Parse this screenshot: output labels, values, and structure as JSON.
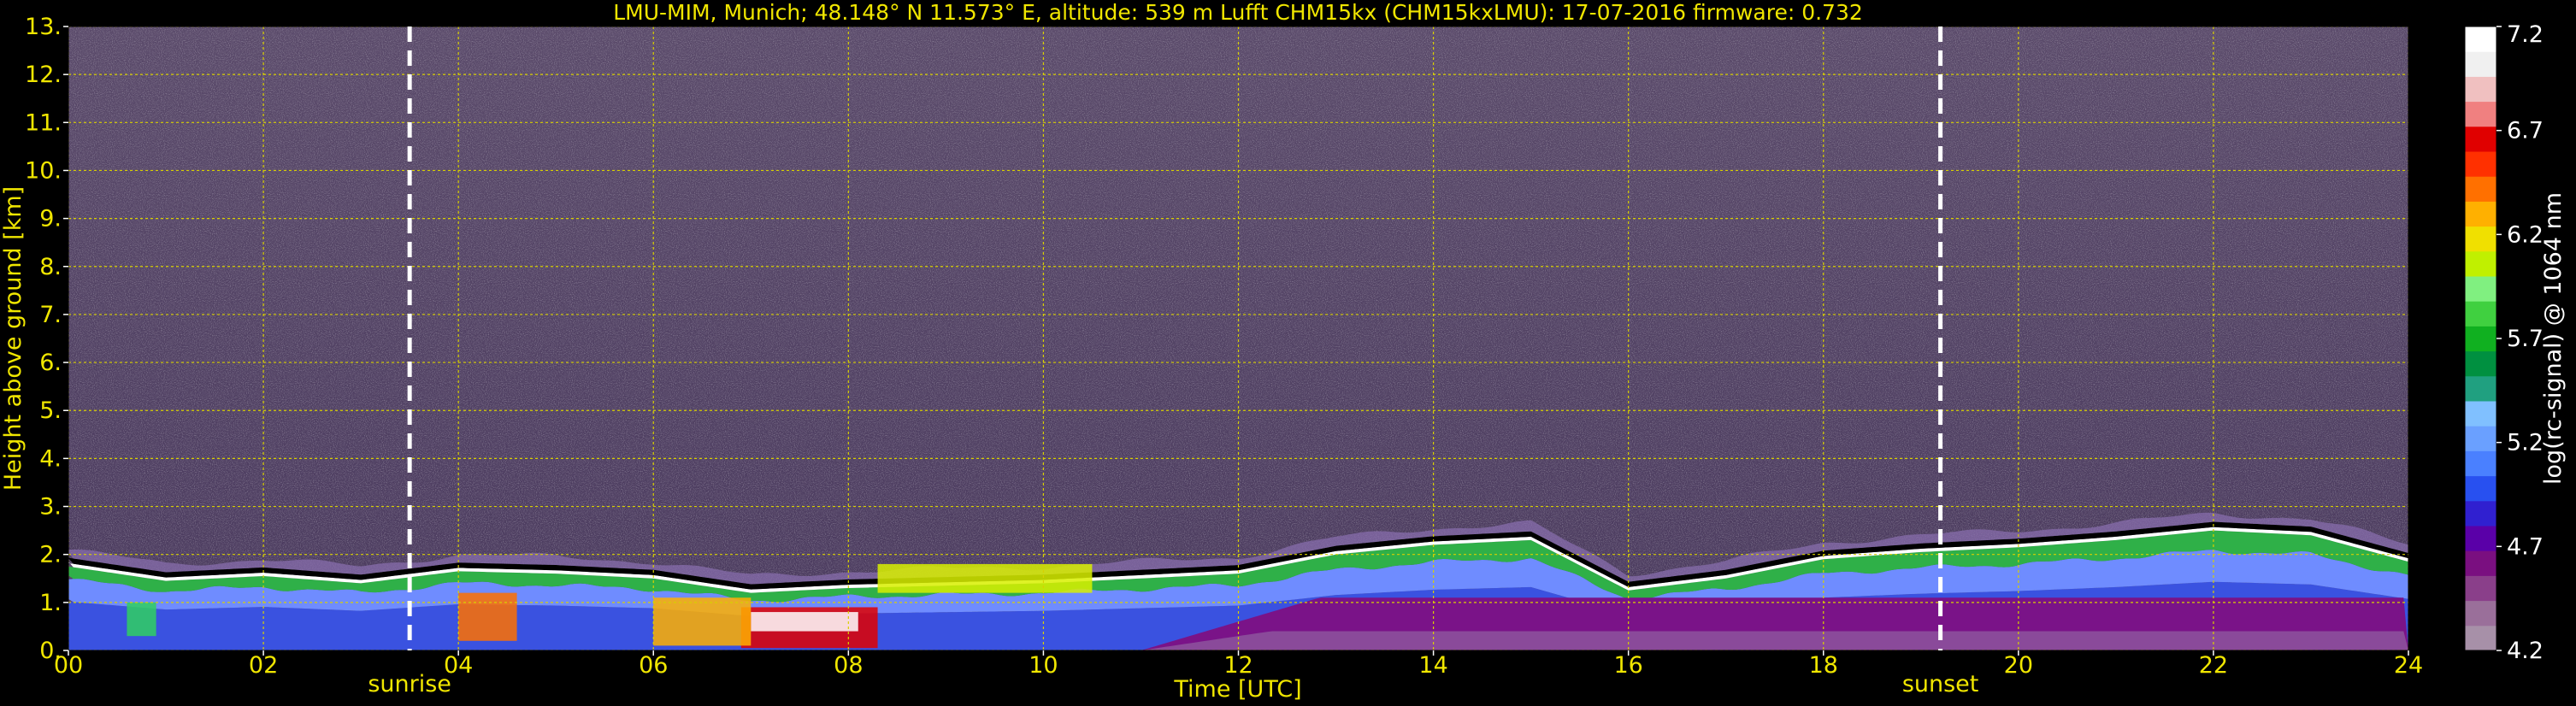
{
  "chart_data": {
    "type": "heatmap",
    "title": "LMU-MIM, Munich; 48.148° N 11.573° E, altitude: 539 m    Lufft CHM15kx (CHM15kxLMU): 17-07-2016    firmware: 0.732",
    "xlabel": "Time [UTC]",
    "ylabel": "Height above ground [km]",
    "xlim": [
      0,
      24
    ],
    "ylim": [
      0,
      13
    ],
    "x_ticks": [
      "00",
      "02",
      "04",
      "06",
      "08",
      "10",
      "12",
      "14",
      "16",
      "18",
      "20",
      "22",
      "24"
    ],
    "y_ticks": [
      "0.",
      "1.",
      "2.",
      "3.",
      "4.",
      "5.",
      "6.",
      "7.",
      "8.",
      "9.",
      "10.",
      "11.",
      "12.",
      "13."
    ],
    "grid": true,
    "markers": [
      {
        "label": "sunrise",
        "time": 3.5
      },
      {
        "label": "sunset",
        "time": 19.2
      }
    ],
    "colorbar": {
      "label": "log(rc-signal) @ 1064 nm",
      "range": [
        4.2,
        7.2
      ],
      "ticks": [
        "4.2",
        "4.7",
        "5.2",
        "5.7",
        "6.2",
        "6.7",
        "7.2"
      ],
      "colors": [
        "#a790a8",
        "#9a6f9a",
        "#8a3f8a",
        "#7a0f80",
        "#5a00a8",
        "#3020d0",
        "#2850f0",
        "#4a80ff",
        "#6aa0ff",
        "#80c0ff",
        "#20a080",
        "#009040",
        "#10b020",
        "#40d040",
        "#80f080",
        "#c0f000",
        "#f0e000",
        "#ffb000",
        "#ff7000",
        "#ff3000",
        "#e00000",
        "#f08080",
        "#f0c0c0",
        "#f0f0f0",
        "#ffffff"
      ]
    },
    "boundary_layer_top_km": {
      "time": [
        0,
        1,
        2,
        3,
        4,
        5,
        6,
        7,
        8,
        9,
        10,
        11,
        12,
        13,
        14,
        15,
        16,
        17,
        18,
        19,
        20,
        21,
        22,
        23,
        24
      ],
      "height": [
        1.85,
        1.55,
        1.65,
        1.5,
        1.75,
        1.7,
        1.6,
        1.3,
        1.4,
        1.45,
        1.5,
        1.6,
        1.7,
        2.1,
        2.3,
        2.4,
        1.35,
        1.6,
        2.0,
        2.15,
        2.25,
        2.4,
        2.6,
        2.5,
        1.95
      ]
    }
  }
}
